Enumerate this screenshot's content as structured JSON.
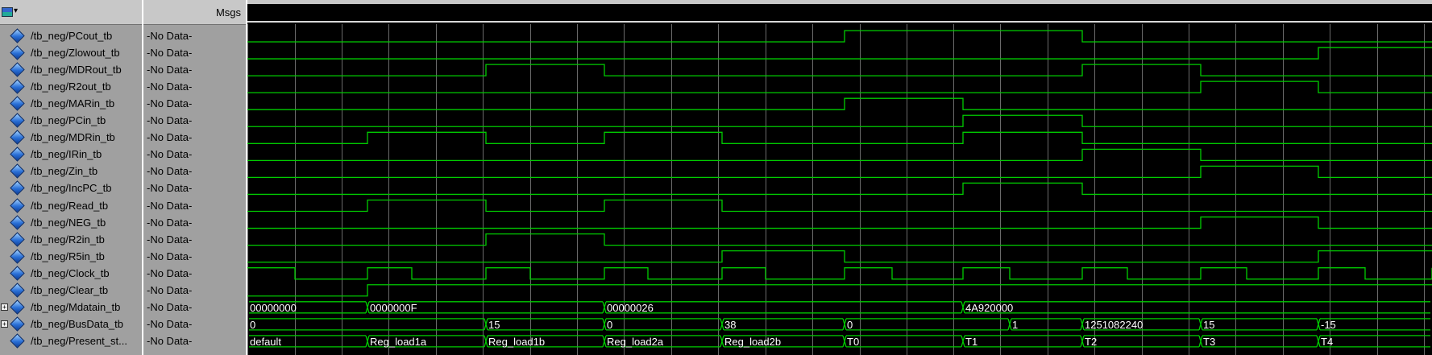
{
  "header": {
    "msgs_label": "Msgs",
    "tool_icon": "wave-tool-icon",
    "caret": "▾"
  },
  "no_data": "-No Data-",
  "signals": [
    {
      "name": "/tb_neg/PCout_tb",
      "type": "bit",
      "expandable": false
    },
    {
      "name": "/tb_neg/Zlowout_tb",
      "type": "bit",
      "expandable": false
    },
    {
      "name": "/tb_neg/MDRout_tb",
      "type": "bit",
      "expandable": false
    },
    {
      "name": "/tb_neg/R2out_tb",
      "type": "bit",
      "expandable": false
    },
    {
      "name": "/tb_neg/MARin_tb",
      "type": "bit",
      "expandable": false
    },
    {
      "name": "/tb_neg/PCin_tb",
      "type": "bit",
      "expandable": false
    },
    {
      "name": "/tb_neg/MDRin_tb",
      "type": "bit",
      "expandable": false
    },
    {
      "name": "/tb_neg/IRin_tb",
      "type": "bit",
      "expandable": false
    },
    {
      "name": "/tb_neg/Zin_tb",
      "type": "bit",
      "expandable": false
    },
    {
      "name": "/tb_neg/IncPC_tb",
      "type": "bit",
      "expandable": false
    },
    {
      "name": "/tb_neg/Read_tb",
      "type": "bit",
      "expandable": false
    },
    {
      "name": "/tb_neg/NEG_tb",
      "type": "bit",
      "expandable": false
    },
    {
      "name": "/tb_neg/R2in_tb",
      "type": "bit",
      "expandable": false
    },
    {
      "name": "/tb_neg/R5in_tb",
      "type": "bit",
      "expandable": false
    },
    {
      "name": "/tb_neg/Clock_tb",
      "type": "bit",
      "expandable": false
    },
    {
      "name": "/tb_neg/Clear_tb",
      "type": "bit",
      "expandable": false
    },
    {
      "name": "/tb_neg/Mdatain_tb",
      "type": "bus",
      "expandable": true
    },
    {
      "name": "/tb_neg/BusData_tb",
      "type": "bus",
      "expandable": true
    },
    {
      "name": "/tb_neg/Present_st...",
      "type": "bus",
      "expandable": false
    }
  ],
  "bus_labels": {
    "Mdatain_tb": [
      "00000000",
      "0000000F",
      "00000026",
      "4A920000"
    ],
    "BusData_tb": [
      "0",
      "15",
      "0",
      "38",
      "0",
      "1",
      "1251082240",
      "15",
      "-15"
    ],
    "Present_state": [
      "default",
      "Reg_load1a",
      "Reg_load1b",
      "Reg_load2a",
      "Reg_load2b",
      "T0",
      "T1",
      "T2",
      "T3",
      "T4"
    ]
  },
  "colors": {
    "wave": "#00cc00",
    "grid": "#6a6a6a",
    "wave_bg": "#000000",
    "pane_bg": "#a0a0a0",
    "text_on_wave": "#ffffff"
  }
}
